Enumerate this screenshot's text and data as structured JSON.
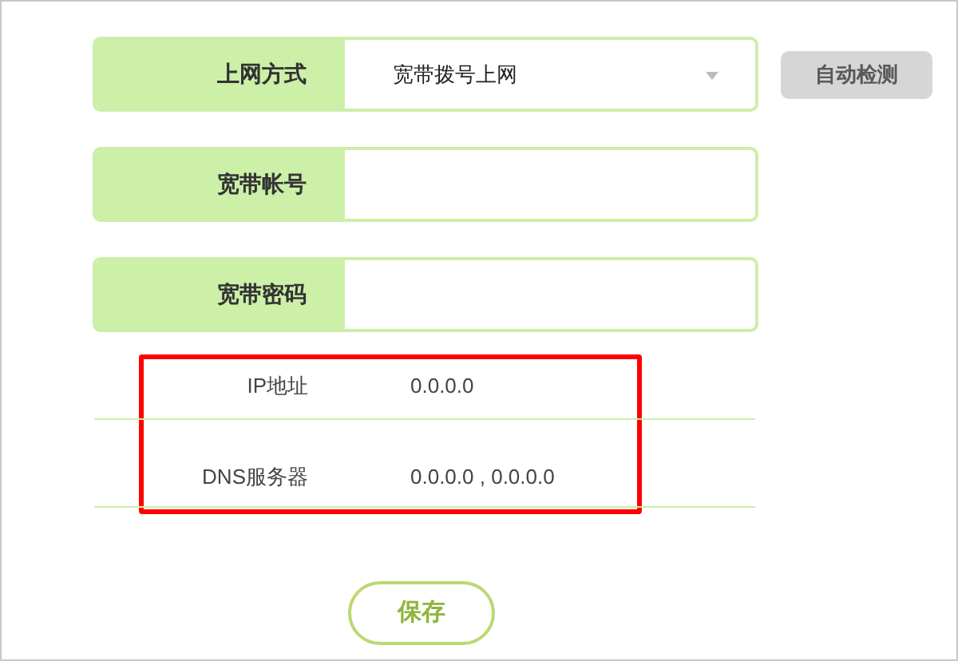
{
  "form_rows": [
    {
      "label": "上网方式",
      "value": "宽带拨号上网",
      "kind": "select"
    },
    {
      "label": "宽带帐号",
      "value": "",
      "kind": "input"
    },
    {
      "label": "宽带密码",
      "value": "",
      "kind": "input"
    }
  ],
  "detect_button": "自动检测",
  "info_rows": [
    {
      "label": "IP地址",
      "value": "0.0.0.0"
    },
    {
      "label": "DNS服务器",
      "value": "0.0.0.0 , 0.0.0.0"
    }
  ],
  "save_button": "保存"
}
